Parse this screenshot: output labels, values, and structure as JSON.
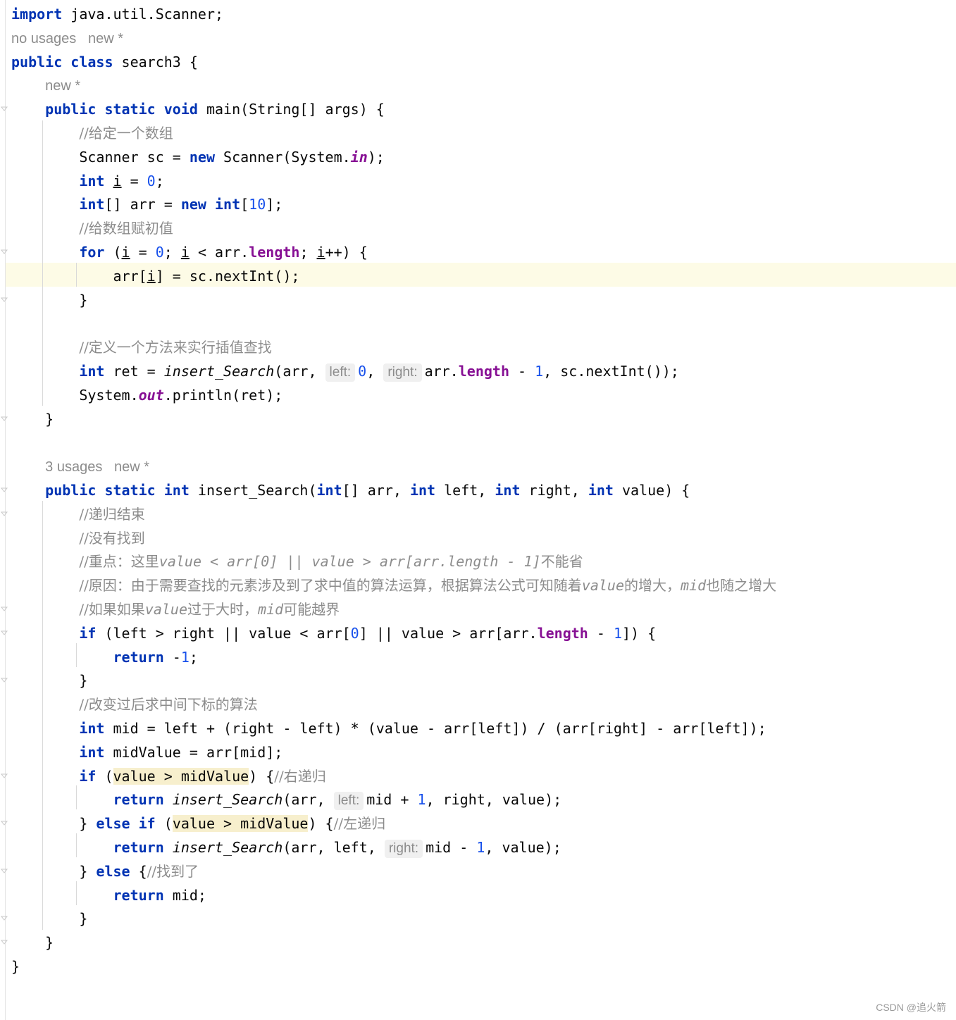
{
  "editor": {
    "lines": [
      [
        {
          "t": "import",
          "c": "kw"
        },
        {
          "t": " java.util.Scanner;"
        }
      ],
      [
        {
          "t": "no usages   new *",
          "c": "meta"
        }
      ],
      [
        {
          "t": "public class",
          "c": "kw"
        },
        {
          "t": " search3 {"
        }
      ],
      [
        {
          "t": "    "
        },
        {
          "t": "new *",
          "c": "meta"
        }
      ],
      [
        {
          "t": "    "
        },
        {
          "t": "public static void",
          "c": "kw"
        },
        {
          "t": " main(String[] args) {"
        }
      ],
      [
        {
          "t": "        "
        },
        {
          "t": "//给定一个数组",
          "c": "cmtzh"
        }
      ],
      [
        {
          "t": "        Scanner sc = "
        },
        {
          "t": "new",
          "c": "kw"
        },
        {
          "t": " Scanner(System."
        },
        {
          "t": "in",
          "c": "sfield"
        },
        {
          "t": ");"
        }
      ],
      [
        {
          "t": "        "
        },
        {
          "t": "int",
          "c": "kw"
        },
        {
          "t": " "
        },
        {
          "t": "i",
          "c": "ul"
        },
        {
          "t": " = "
        },
        {
          "t": "0",
          "c": "num"
        },
        {
          "t": ";"
        }
      ],
      [
        {
          "t": "        "
        },
        {
          "t": "int",
          "c": "kw"
        },
        {
          "t": "[] arr = "
        },
        {
          "t": "new int",
          "c": "kw"
        },
        {
          "t": "["
        },
        {
          "t": "10",
          "c": "num"
        },
        {
          "t": "];"
        }
      ],
      [
        {
          "t": "        "
        },
        {
          "t": "//给数组赋初值",
          "c": "cmtzh"
        }
      ],
      [
        {
          "t": "        "
        },
        {
          "t": "for",
          "c": "kw"
        },
        {
          "t": " ("
        },
        {
          "t": "i",
          "c": "ul"
        },
        {
          "t": " = "
        },
        {
          "t": "0",
          "c": "num"
        },
        {
          "t": "; "
        },
        {
          "t": "i",
          "c": "ul"
        },
        {
          "t": " < arr."
        },
        {
          "t": "length",
          "c": "field"
        },
        {
          "t": "; "
        },
        {
          "t": "i",
          "c": "ul"
        },
        {
          "t": "++) {"
        }
      ],
      [
        {
          "t": "            arr["
        },
        {
          "t": "i",
          "c": "ul"
        },
        {
          "t": "] = sc.nextInt();"
        }
      ],
      [
        {
          "t": "        }"
        }
      ],
      [
        {
          "t": ""
        }
      ],
      [
        {
          "t": "        "
        },
        {
          "t": "//定义一个方法来实行插值查找",
          "c": "cmtzh"
        }
      ],
      [
        {
          "t": "        "
        },
        {
          "t": "int",
          "c": "kw"
        },
        {
          "t": " ret = "
        },
        {
          "t": "insert_Search",
          "c": "meth-i"
        },
        {
          "t": "(arr, "
        },
        {
          "t": "left:",
          "c": "hint"
        },
        {
          "t": "0",
          "c": "num"
        },
        {
          "t": ", "
        },
        {
          "t": "right:",
          "c": "hint"
        },
        {
          "t": "arr."
        },
        {
          "t": "length",
          "c": "field"
        },
        {
          "t": " - "
        },
        {
          "t": "1",
          "c": "num"
        },
        {
          "t": ", sc.nextInt());"
        }
      ],
      [
        {
          "t": "        System."
        },
        {
          "t": "out",
          "c": "sfield"
        },
        {
          "t": ".println(ret);"
        }
      ],
      [
        {
          "t": "    }"
        }
      ],
      [
        {
          "t": ""
        }
      ],
      [
        {
          "t": "    "
        },
        {
          "t": "3 usages   new *",
          "c": "meta"
        }
      ],
      [
        {
          "t": "    "
        },
        {
          "t": "public static int",
          "c": "kw"
        },
        {
          "t": " insert_Search("
        },
        {
          "t": "int",
          "c": "kw"
        },
        {
          "t": "[] arr, "
        },
        {
          "t": "int",
          "c": "kw"
        },
        {
          "t": " left, "
        },
        {
          "t": "int",
          "c": "kw"
        },
        {
          "t": " right, "
        },
        {
          "t": "int",
          "c": "kw"
        },
        {
          "t": " value) {"
        }
      ],
      [
        {
          "t": "        "
        },
        {
          "t": "//递归结束",
          "c": "cmtzh"
        }
      ],
      [
        {
          "t": "        "
        },
        {
          "t": "//没有找到",
          "c": "cmtzh"
        }
      ],
      [
        {
          "t": "        "
        },
        {
          "t": "//重点：这里",
          "c": "cmtzh"
        },
        {
          "t": "value < arr[0] || value > arr[arr.length - 1]",
          "c": "cmt"
        },
        {
          "t": "不能省",
          "c": "cmtzh"
        }
      ],
      [
        {
          "t": "        "
        },
        {
          "t": "//原因：由于需要查找的元素涉及到了求中值的算法运算，根据算法公式可知随着",
          "c": "cmtzh"
        },
        {
          "t": "value",
          "c": "cmt"
        },
        {
          "t": "的增大，",
          "c": "cmtzh"
        },
        {
          "t": "mid",
          "c": "cmt"
        },
        {
          "t": "也随之增大",
          "c": "cmtzh"
        }
      ],
      [
        {
          "t": "        "
        },
        {
          "t": "//如果如果",
          "c": "cmtzh"
        },
        {
          "t": "value",
          "c": "cmt"
        },
        {
          "t": "过于大时，",
          "c": "cmtzh"
        },
        {
          "t": "mid",
          "c": "cmt"
        },
        {
          "t": "可能越界",
          "c": "cmtzh"
        }
      ],
      [
        {
          "t": "        "
        },
        {
          "t": "if",
          "c": "kw"
        },
        {
          "t": " (left > right || value < arr["
        },
        {
          "t": "0",
          "c": "num"
        },
        {
          "t": "] || value > arr[arr."
        },
        {
          "t": "length",
          "c": "field"
        },
        {
          "t": " - "
        },
        {
          "t": "1",
          "c": "num"
        },
        {
          "t": "]) {"
        }
      ],
      [
        {
          "t": "            "
        },
        {
          "t": "return",
          "c": "kw"
        },
        {
          "t": " -"
        },
        {
          "t": "1",
          "c": "num"
        },
        {
          "t": ";"
        }
      ],
      [
        {
          "t": "        }"
        }
      ],
      [
        {
          "t": "        "
        },
        {
          "t": "//改变过后求中间下标的算法",
          "c": "cmtzh"
        }
      ],
      [
        {
          "t": "        "
        },
        {
          "t": "int",
          "c": "kw"
        },
        {
          "t": " mid = left + (right - left) * (value - arr[left]) / (arr[right] - arr[left]);"
        }
      ],
      [
        {
          "t": "        "
        },
        {
          "t": "int",
          "c": "kw"
        },
        {
          "t": " midValue = arr[mid];"
        }
      ],
      [
        {
          "t": "        "
        },
        {
          "t": "if",
          "c": "kw"
        },
        {
          "t": " ("
        },
        {
          "t": "value > midValue",
          "c": "ident-hl"
        },
        {
          "t": ") {"
        },
        {
          "t": "//右递归",
          "c": "cmtzh"
        }
      ],
      [
        {
          "t": "            "
        },
        {
          "t": "return",
          "c": "kw"
        },
        {
          "t": " "
        },
        {
          "t": "insert_Search",
          "c": "meth-i"
        },
        {
          "t": "(arr, "
        },
        {
          "t": "left:",
          "c": "hint"
        },
        {
          "t": "mid + "
        },
        {
          "t": "1",
          "c": "num"
        },
        {
          "t": ", right, value);"
        }
      ],
      [
        {
          "t": "        } "
        },
        {
          "t": "else if",
          "c": "kw"
        },
        {
          "t": " ("
        },
        {
          "t": "value > midValue",
          "c": "ident-hl"
        },
        {
          "t": ") {"
        },
        {
          "t": "//左递归",
          "c": "cmtzh"
        }
      ],
      [
        {
          "t": "            "
        },
        {
          "t": "return",
          "c": "kw"
        },
        {
          "t": " "
        },
        {
          "t": "insert_Search",
          "c": "meth-i"
        },
        {
          "t": "(arr, left, "
        },
        {
          "t": "right:",
          "c": "hint"
        },
        {
          "t": "mid - "
        },
        {
          "t": "1",
          "c": "num"
        },
        {
          "t": ", value);"
        }
      ],
      [
        {
          "t": "        } "
        },
        {
          "t": "else",
          "c": "kw"
        },
        {
          "t": " {"
        },
        {
          "t": "//找到了",
          "c": "cmtzh"
        }
      ],
      [
        {
          "t": "            "
        },
        {
          "t": "return",
          "c": "kw"
        },
        {
          "t": " mid;"
        }
      ],
      [
        {
          "t": "        }"
        }
      ],
      [
        {
          "t": "    }"
        }
      ],
      [
        {
          "t": "}"
        }
      ]
    ]
  },
  "watermark": "CSDN @追火箭"
}
